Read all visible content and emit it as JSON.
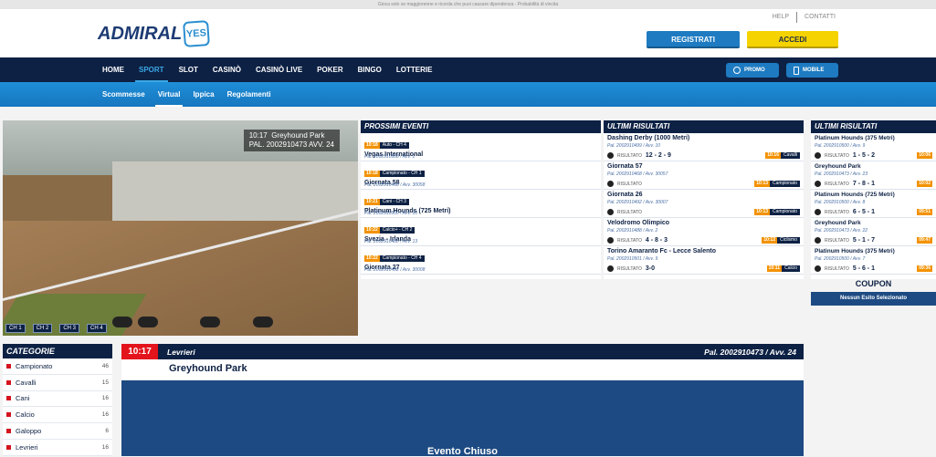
{
  "top_notice": "Gioca solo se maggiorenne e ricorda che puoi causare dipendenza - Probabilità di vincita",
  "logo": {
    "word": "ADMIRAL",
    "badge": "YES"
  },
  "header": {
    "help": "HELP",
    "contacts": "CONTATTI",
    "register": "REGISTRATI",
    "login": "ACCEDI"
  },
  "nav": [
    "HOME",
    "SPORT",
    "SLOT",
    "CASINÒ",
    "CASINÒ LIVE",
    "POKER",
    "BINGO",
    "LOTTERIE"
  ],
  "nav_right": {
    "promo": "PROMO",
    "mobile": "MOBILE"
  },
  "subnav": [
    "Scommesse",
    "Virtual",
    "Ippica",
    "Regolamenti"
  ],
  "video": {
    "time": "10:17",
    "venue": "Greyhound Park",
    "pal": "PAL. 2002910473 AVV. 24",
    "channels": [
      "CH 1",
      "CH 2",
      "CH 3",
      "CH 4"
    ]
  },
  "next_events": {
    "title": "PROSSIMI EVENTI",
    "items": [
      {
        "time": "10:18",
        "cat": "Auto - CH 4",
        "name": "Vegas International",
        "pal": "Pal. 2002910508 / Avv. 1"
      },
      {
        "time": "10:18",
        "cat": "Campionato - CH 1",
        "name": "Giornata 58",
        "pal": "Pal. 2002910468 / Avv. 30058"
      },
      {
        "time": "10:21",
        "cat": "Cani - CH 3",
        "name": "Platinum Hounds (725 Metri)",
        "pal": "Pal. 2002910500 / Avv. 10"
      },
      {
        "time": "10:22",
        "cat": "Calcio+ - CH 2",
        "name": "Svezia - Irlanda",
        "pal": "Pal. 2002910480 / Avv. 13"
      },
      {
        "time": "10:22",
        "cat": "Campionato - CH 4",
        "name": "Giornata 27",
        "pal": "Pal. 2002910492 / Avv. 30008"
      }
    ]
  },
  "last_results": {
    "title": "ULTIMI RISULTATI",
    "label": "RISULTATO",
    "items": [
      {
        "name": "Dashing Derby (1000 Metri)",
        "pal": "Pal. 2002910499 / Avv. 10",
        "result": "12 - 2 - 9",
        "time": "10:16",
        "cat": "Cavalli"
      },
      {
        "name": "Giornata 57",
        "pal": "Pal. 2002910468 / Avv. 30057",
        "result": "",
        "time": "10:13",
        "cat": "Campionato"
      },
      {
        "name": "Giornata 26",
        "pal": "Pal. 2002910492 / Avv. 30007",
        "result": "",
        "time": "10:13",
        "cat": "Campionato"
      },
      {
        "name": "Velodromo Olimpico",
        "pal": "Pal. 2002910488 / Avv. 2",
        "result": "4 - 8 - 3",
        "time": "10:12",
        "cat": "Ciclismo"
      },
      {
        "name": "Torino Amaranto Fc - Lecce Salento",
        "pal": "Pal. 2002910501 / Avv. 9",
        "result": "3-0",
        "time": "10:11",
        "cat": "Calcio"
      }
    ]
  },
  "side_results": {
    "title": "ULTIMI RISULTATI",
    "label": "RISULTATO",
    "items": [
      {
        "name": "Platinum Hounds (375 Metri)",
        "pal": "Pal. 2002910500 / Avv. 9",
        "result": "1 - 5 - 2",
        "time": "10:06"
      },
      {
        "name": "Greyhound Park",
        "pal": "Pal. 2002910473 / Avv. 23",
        "result": "7 - 8 - 1",
        "time": "10:02"
      },
      {
        "name": "Platinum Hounds (725 Metri)",
        "pal": "Pal. 2002910500 / Avv. 8",
        "result": "6 - 5 - 1",
        "time": "09:51"
      },
      {
        "name": "Greyhound Park",
        "pal": "Pal. 2002910473 / Avv. 22",
        "result": "5 - 1 - 7",
        "time": "09:47"
      },
      {
        "name": "Platinum Hounds (375 Metri)",
        "pal": "Pal. 2002910500 / Avv. 7",
        "result": "5 - 6 - 1",
        "time": "09:36"
      }
    ]
  },
  "coupon": {
    "title": "COUPON",
    "empty": "Nessun Esito Selezionato"
  },
  "categories": {
    "title": "CATEGORIE",
    "items": [
      {
        "name": "Campionato",
        "count": "46"
      },
      {
        "name": "Cavalli",
        "count": "15"
      },
      {
        "name": "Cani",
        "count": "16"
      },
      {
        "name": "Calcio",
        "count": "16"
      },
      {
        "name": "Galoppo",
        "count": "6"
      },
      {
        "name": "Levrieri",
        "count": "16"
      }
    ]
  },
  "detail": {
    "time": "10:17",
    "category": "Levrieri",
    "pal": "Pal. 2002910473 / Avv. 24",
    "title": "Greyhound Park",
    "status": "Evento Chiuso"
  }
}
